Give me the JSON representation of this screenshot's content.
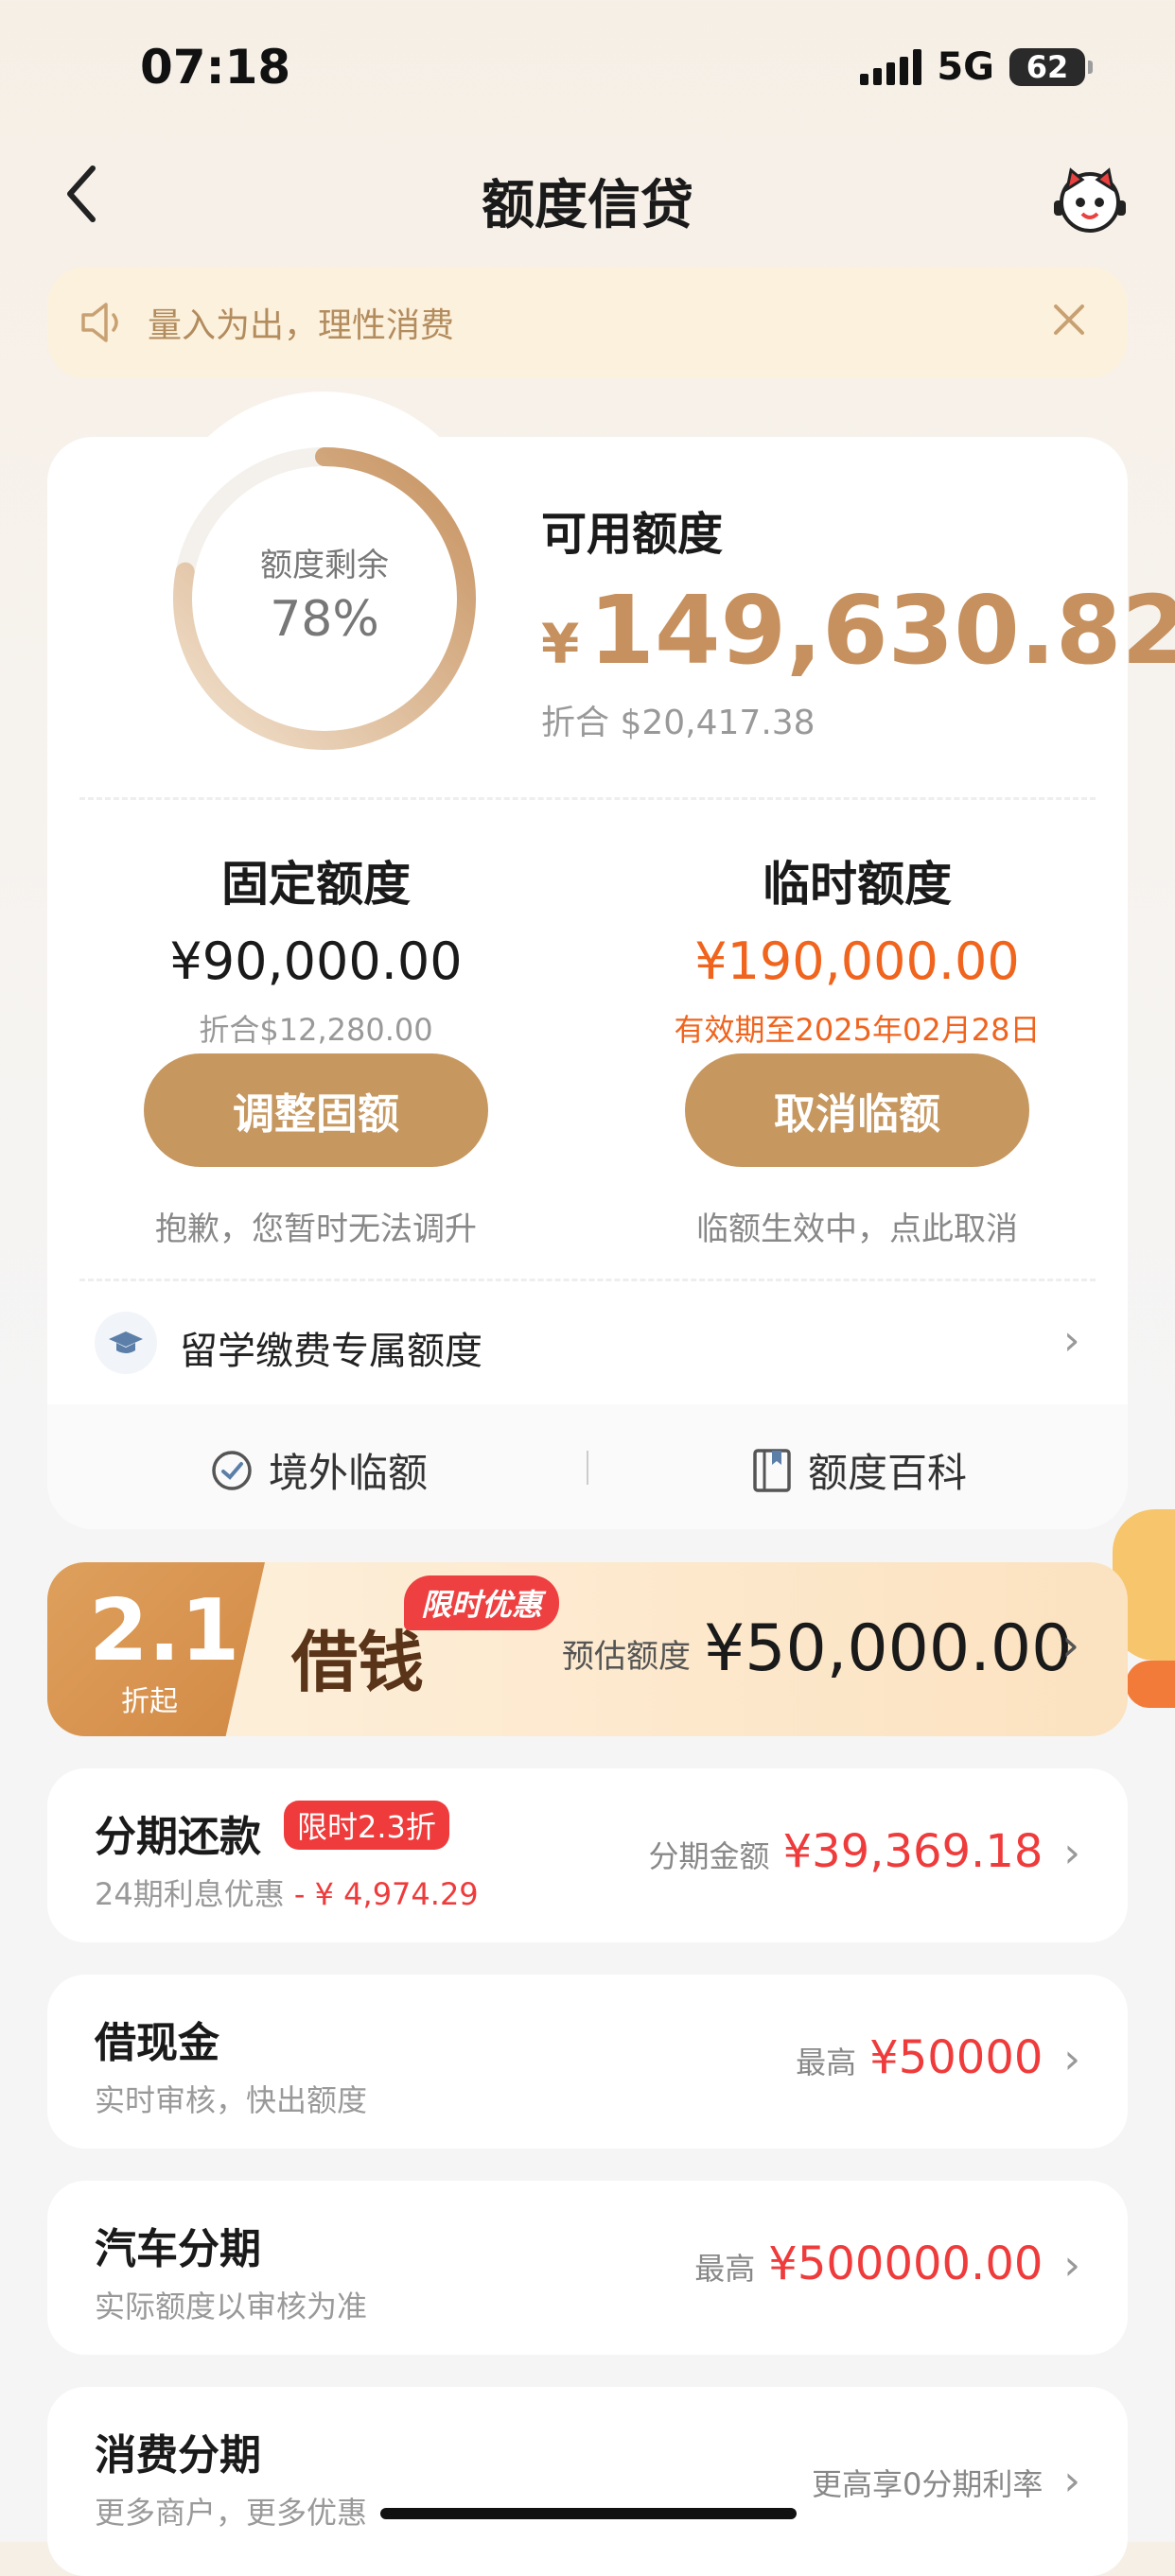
{
  "status": {
    "time": "07:18",
    "network": "5G",
    "battery": "62"
  },
  "nav": {
    "title": "额度信贷",
    "back_icon": "chevron-left-icon",
    "mascot_icon": "mascot-icon"
  },
  "notice": {
    "text": "量入为出，理性消费"
  },
  "credit": {
    "ring_label": "额度剩余",
    "ring_percent": "78%",
    "ring_value": 0.78,
    "available_label": "可用额度",
    "available_currency": "¥",
    "available_amount": "149,630.82",
    "available_converted": "折合 $20,417.38",
    "fixed": {
      "title": "固定额度",
      "amount": "¥90,000.00",
      "sub": "折合$12,280.00",
      "button": "调整固额",
      "note": "抱歉，您暂时无法调升"
    },
    "temp": {
      "title": "临时额度",
      "amount": "¥190,000.00",
      "sub": "有效期至2025年02月28日",
      "button": "取消临额",
      "note": "临额生效中，点此取消"
    },
    "study_label": "留学缴费专属额度",
    "tools": [
      {
        "label": "境外临额"
      },
      {
        "label": "额度百科"
      }
    ]
  },
  "loan": {
    "rate": "2.1",
    "rate_sub": "折起",
    "title": "借钱",
    "badge": "限时优惠",
    "estimate_label": "预估额度",
    "estimate_amount": "¥50,000.00"
  },
  "products": [
    {
      "title": "分期还款",
      "badge": "限时2.3折",
      "sub_prefix": "24期利息优惠",
      "sub_value": " - ¥ 4,974.29",
      "right_label": "分期金额",
      "right_value": "¥39,369.18"
    },
    {
      "title": "借现金",
      "sub": "实时审核，快出额度",
      "right_label": "最高",
      "right_value": "¥50000"
    },
    {
      "title": "汽车分期",
      "sub": "实际额度以审核为准",
      "right_label": "最高",
      "right_value": "¥500000.00"
    },
    {
      "title": "消费分期",
      "sub": "更多商户，更多优惠",
      "right_label": "更高享0分期利率"
    }
  ],
  "colors": {
    "accent": "#c6915e",
    "orange": "#f0641e",
    "red": "#ef3b3b"
  }
}
